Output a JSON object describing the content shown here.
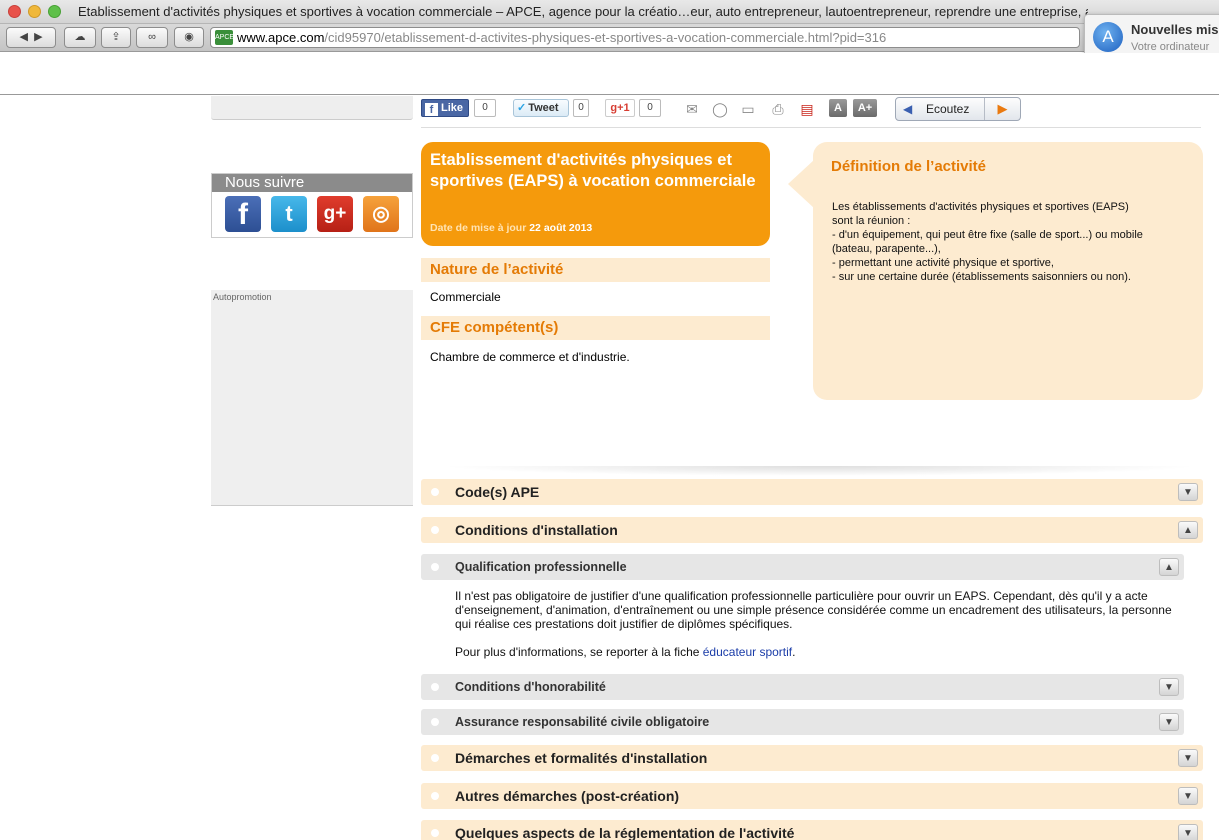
{
  "browser": {
    "window_title": "Etablissement d'activités physiques et sportives à vocation commerciale – APCE, agence pour la créatio…eur, auto entrepreneur, lautoentrepreneur, reprendre une entreprise, aides",
    "address_domain": "www.apce.com",
    "address_path": "/cid95970/etablissement-d-activites-physiques-et-sportives-a-vocation-commerciale.html?pid=316",
    "favicon_text": "APCE",
    "notification_title": "Nouvelles mis",
    "notification_sub": "Votre ordinateur"
  },
  "sidebar": {
    "follow_title": "Nous suivre",
    "autopromo_label": "Autopromotion"
  },
  "sharebar": {
    "like_label": "Like",
    "like_count": "0",
    "tweet_label": "Tweet",
    "tweet_count": "0",
    "gplus_label": "+1",
    "gplus_count": "0",
    "listen_label": "Ecoutez"
  },
  "header": {
    "title": "Etablissement d'activités physiques et sportives (EAPS) à vocation commerciale",
    "date_label": "Date de mise à jour",
    "date_value": "22 août 2013"
  },
  "nature": {
    "title": "Nature de l’activité",
    "value": "Commerciale"
  },
  "cfe": {
    "title": "CFE compétent(s)",
    "value": "Chambre de commerce et d'industrie."
  },
  "definition": {
    "title": "Définition de l’activité",
    "lines": [
      "Les établissements d'activités physiques et sportives (EAPS)",
      "sont la réunion :",
      "- d'un équipement, qui peut être fixe (salle de sport...) ou mobile",
      "(bateau, parapente...),",
      "- permettant une activité physique et sportive,",
      "- sur une certaine durée (établissements saisonniers ou non)."
    ]
  },
  "accordion": {
    "code_ape": "Code(s) APE",
    "conditions": "Conditions d'installation",
    "qualification": "Qualification professionnelle",
    "qualification_text": "Il n'est pas obligatoire de justifier d'une qualification professionnelle particulière pour ouvrir un EAPS. Cependant, dès qu'il y a acte d'enseignement, d'animation, d'entraînement ou une simple présence considérée comme un encadrement des utilisateurs, la personne qui réalise ces prestations doit justifier de diplômes spécifiques.",
    "more_prefix": "Pour plus d'informations, se reporter à la fiche ",
    "more_link": "éducateur sportif",
    "more_suffix": ".",
    "honorabilite": "Conditions d'honorabilité",
    "assurance": "Assurance responsabilité civile obligatoire",
    "demarches": "Démarches et formalités d'installation",
    "autres": "Autres démarches (post-création)",
    "reglementation": "Quelques aspects de la réglementation de l'activité"
  },
  "colors": {
    "orange": "#f59a0c",
    "orange_text": "#e47b06",
    "pale_orange": "#fdebd0",
    "grey_row": "#e6e6e6"
  }
}
